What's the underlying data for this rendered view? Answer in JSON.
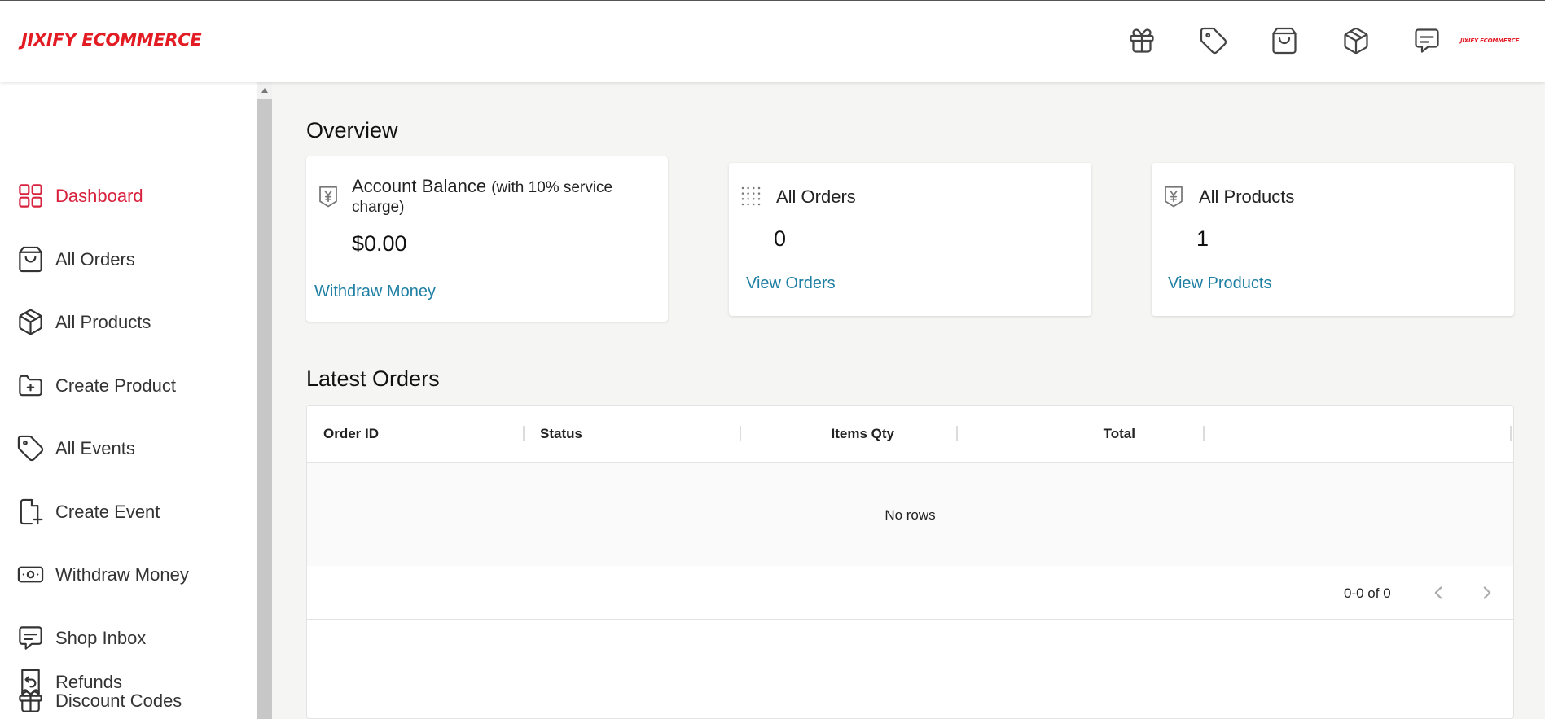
{
  "header": {
    "logo": "JIXIFY ECOMMERCE",
    "avatar_text": "JIXIFY ECOMMERCE",
    "icons": [
      {
        "name": "gift-icon",
        "title": "Discount Codes"
      },
      {
        "name": "tag-icon",
        "title": "Events"
      },
      {
        "name": "shopping-bag-icon",
        "title": "Orders"
      },
      {
        "name": "package-icon",
        "title": "Products"
      },
      {
        "name": "message-icon",
        "title": "Inbox"
      }
    ]
  },
  "sidebar": {
    "items": [
      {
        "label": "Dashboard",
        "icon": "grid-icon",
        "active": true
      },
      {
        "label": "All Orders",
        "icon": "shopping-bag-icon"
      },
      {
        "label": "All Products",
        "icon": "package-icon"
      },
      {
        "label": "Create Product",
        "icon": "folder-plus-icon"
      },
      {
        "label": "All Events",
        "icon": "tag-icon"
      },
      {
        "label": "Create Event",
        "icon": "file-plus-icon"
      },
      {
        "label": "Withdraw Money",
        "icon": "banknote-icon"
      },
      {
        "label": "Shop Inbox",
        "icon": "message-icon"
      },
      {
        "label": "Discount Codes",
        "icon": "gift-icon"
      },
      {
        "label": "Refunds",
        "icon": "receipt-refund-icon"
      }
    ]
  },
  "overview": {
    "title": "Overview",
    "balance": {
      "title": "Account Balance",
      "subtitle": "(with 10% service",
      "subtitle2": "charge)",
      "value": "$0.00",
      "link": "Withdraw Money"
    },
    "orders": {
      "title": "All Orders",
      "value": "0",
      "link": "View Orders"
    },
    "products": {
      "title": "All Products",
      "value": "1",
      "link": "View Products"
    }
  },
  "latest_orders": {
    "title": "Latest Orders",
    "columns": [
      "Order ID",
      "Status",
      "Items Qty",
      "Total"
    ],
    "empty_text": "No rows",
    "pagination": "0-0 of 0"
  },
  "colors": {
    "accent": "#d8213d",
    "brand": "#e31b23",
    "link": "#1e7fa3"
  }
}
